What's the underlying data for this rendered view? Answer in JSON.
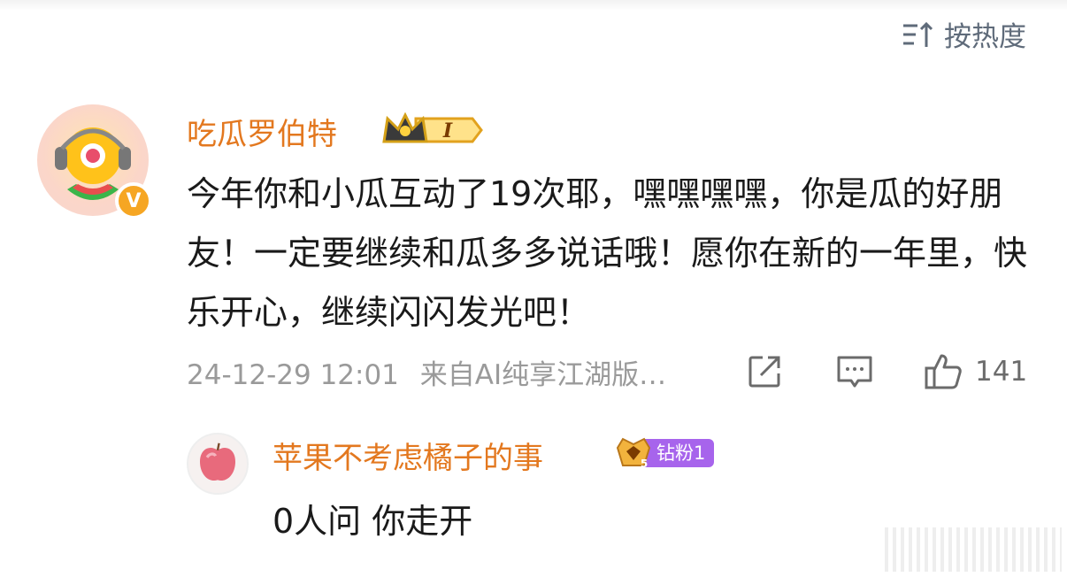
{
  "sort": {
    "label": "按热度"
  },
  "comment": {
    "username": "吃瓜罗伯特",
    "level_badge": "I",
    "verified_badge": "V",
    "text": "今年你和小瓜互动了19次耶，嘿嘿嘿嘿，你是瓜的好朋友！一定要继续和瓜多多说话哦！愿你在新的一年里，快乐开心，继续闪闪发光吧！",
    "timestamp": "24-12-29 12:01",
    "source": "来自AI纯享江湖版…",
    "like_count": "141"
  },
  "reply": {
    "username": "苹果不考虑橘子的事",
    "fan_badge_level": "5",
    "fan_badge_label": "钻粉1",
    "text": "0人问 你走开"
  },
  "icons": {
    "sort": "sort-icon",
    "share": "share-icon",
    "reply": "comment-icon",
    "like": "thumbs-up-icon"
  },
  "colors": {
    "username": "#e3781f",
    "fan_badge": "#a764ec",
    "verified": "#f6a623"
  }
}
